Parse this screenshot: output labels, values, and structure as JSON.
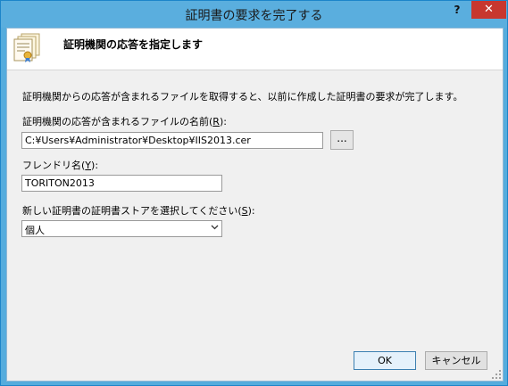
{
  "window": {
    "title": "証明書の要求を完了する",
    "help_label": "?",
    "close_label": "✕"
  },
  "header": {
    "title": "証明機関の応答を指定します"
  },
  "body": {
    "description": "証明機関からの応答が含まれるファイルを取得すると、以前に作成した証明書の要求が完了します。",
    "file": {
      "label_prefix": "証明機関の応答が含まれるファイルの名前(",
      "label_key": "R",
      "label_suffix": "):",
      "value": "C:¥Users¥Administrator¥Desktop¥IIS2013.cer",
      "browse_label": "..."
    },
    "friendly": {
      "label_prefix": "フレンドリ名(",
      "label_key": "Y",
      "label_suffix": "):",
      "value": "TORITON2013"
    },
    "store": {
      "label_prefix": "新しい証明書の証明書ストアを選択してください(",
      "label_key": "S",
      "label_suffix": "):",
      "selected": "個人"
    }
  },
  "footer": {
    "ok_label": "OK",
    "cancel_label": "キャンセル"
  }
}
